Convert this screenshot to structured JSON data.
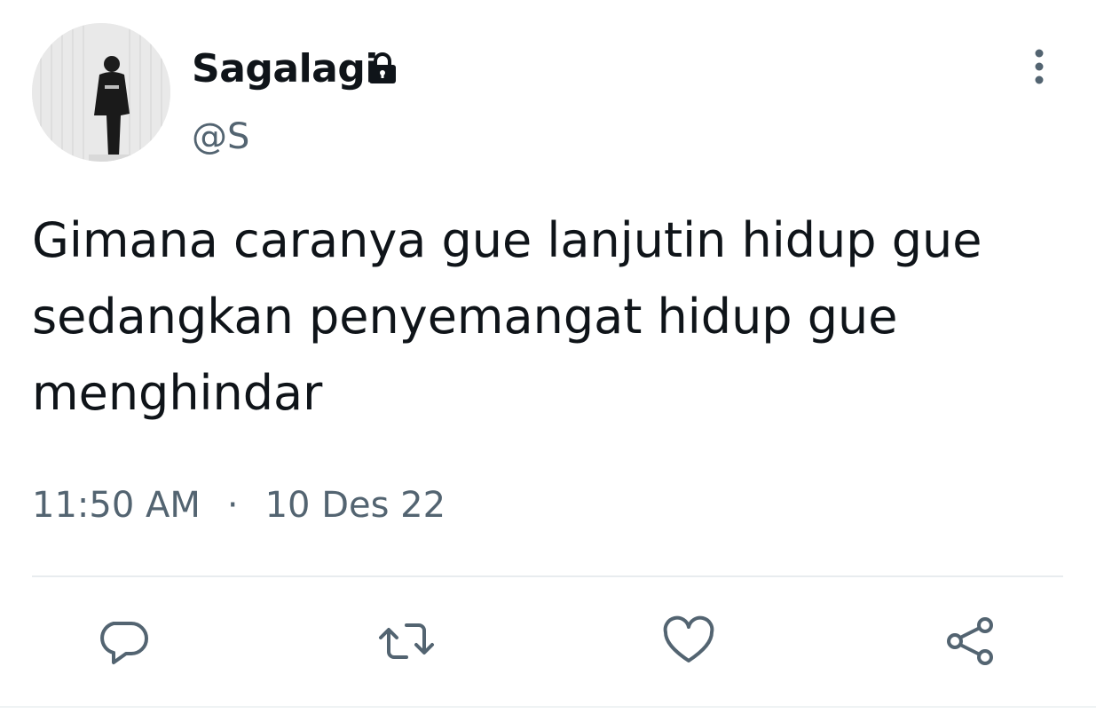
{
  "user": {
    "display_name": "Sagalagi",
    "handle": "@S",
    "protected": true,
    "avatar": "person-photo-grayscale"
  },
  "tweet": {
    "text_lines": [
      "Gimana caranya gue lanjutin hidup gue",
      "sedangkan penyemangat hidup gue",
      "menghindar"
    ],
    "time": "11:50 AM",
    "separator": "·",
    "date": "10 Des 22"
  },
  "actions": [
    {
      "name": "reply",
      "icon": "comment-bubble-icon"
    },
    {
      "name": "retweet",
      "icon": "retweet-icon"
    },
    {
      "name": "like",
      "icon": "heart-icon"
    },
    {
      "name": "share",
      "icon": "share-nodes-icon"
    }
  ],
  "colors": {
    "text_primary": "#0f1419",
    "text_secondary": "#536471",
    "divider": "#e8ecef"
  }
}
